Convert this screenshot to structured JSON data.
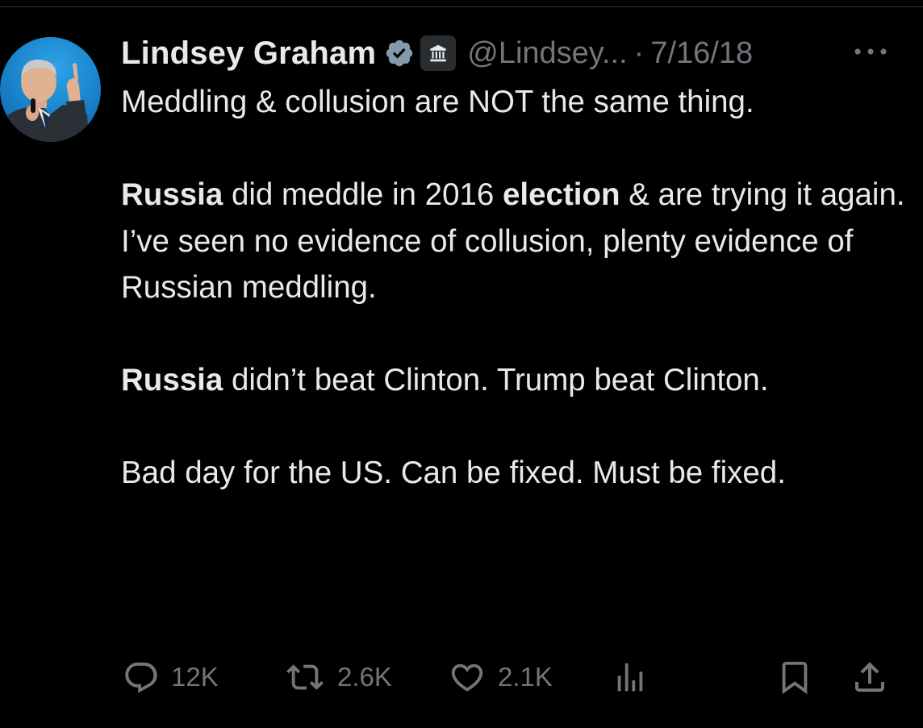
{
  "tweet": {
    "author": {
      "display_name": "Lindsey Graham",
      "handle": "@Lindsey...",
      "verified_icon": "verified-badge-icon",
      "affiliation_icon": "government-building-icon"
    },
    "separator": "·",
    "date": "7/16/18",
    "body": {
      "p1": "Meddling & collusion are NOT the same thing.",
      "p2_bold_1": "Russia",
      "p2_text_1": " did meddle in 2016 ",
      "p2_bold_2": "election",
      "p2_text_2": " & are trying it again. I’ve seen no evidence of collusion, plenty evidence of Russian meddling.",
      "p3_bold": "Russia",
      "p3_text": " didn’t beat Clinton. Trump beat Clinton.",
      "p4": "Bad day for the US. Can be fixed. Must be fixed."
    },
    "actions": {
      "replies": "12K",
      "reposts": "2.6K",
      "likes": "2.1K",
      "views_icon": "analytics-bars-icon",
      "bookmark_icon": "bookmark-icon",
      "share_icon": "share-icon"
    }
  },
  "colors": {
    "background": "#000000",
    "text_primary": "#e7e9ea",
    "text_secondary": "#71767b",
    "verified_blue": "#829aab",
    "avatar_blue": "#1d8fd8"
  }
}
